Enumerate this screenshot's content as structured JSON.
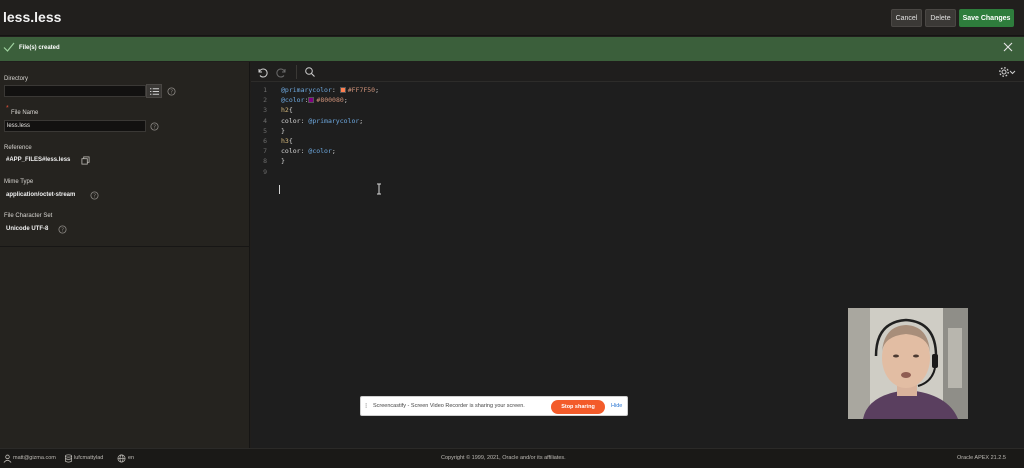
{
  "header": {
    "title": "less.less",
    "cancel_label": "Cancel",
    "delete_label": "Delete",
    "save_label": "Save Changes"
  },
  "banner": {
    "message": "File(s) created"
  },
  "form": {
    "directory": {
      "label": "Directory",
      "value": ""
    },
    "file_name": {
      "label": "File Name",
      "value": "less.less",
      "required_marker": "*"
    },
    "reference": {
      "label": "Reference",
      "value": "#APP_FILES#less.less"
    },
    "mime_type": {
      "label": "Mime Type",
      "value": "application/octet-stream"
    },
    "charset": {
      "label": "File Character Set",
      "value": "Unicode UTF-8"
    }
  },
  "editor": {
    "lines": [
      {
        "num": "1",
        "parts": [
          [
            "kw",
            "@primarycolor"
          ],
          [
            "plain",
            ": "
          ],
          [
            "swatch",
            "#FF7F50"
          ],
          [
            "lit",
            "#FF7F50"
          ],
          [
            "plain",
            ";"
          ]
        ]
      },
      {
        "num": "2",
        "parts": [
          [
            "kw",
            "@color"
          ],
          [
            "plain",
            ":"
          ],
          [
            "swatch",
            "#800080"
          ],
          [
            "lit",
            "#800080"
          ],
          [
            "plain",
            ";"
          ]
        ]
      },
      {
        "num": "3",
        "parts": [
          [
            "sel",
            "h2"
          ],
          [
            "plain",
            "{"
          ]
        ]
      },
      {
        "num": "4",
        "parts": [
          [
            "plain",
            "color: "
          ],
          [
            "kw",
            "@primarycolor"
          ],
          [
            "plain",
            ";"
          ]
        ]
      },
      {
        "num": "5",
        "parts": [
          [
            "plain",
            "}"
          ]
        ]
      },
      {
        "num": "6",
        "parts": [
          [
            "sel",
            "h3"
          ],
          [
            "plain",
            "{"
          ]
        ]
      },
      {
        "num": "7",
        "parts": [
          [
            "plain",
            "color: "
          ],
          [
            "kw",
            "@color"
          ],
          [
            "plain",
            ";"
          ]
        ]
      },
      {
        "num": "8",
        "parts": [
          [
            "plain",
            "}"
          ]
        ]
      },
      {
        "num": "9",
        "parts": []
      }
    ]
  },
  "share_bar": {
    "grip": "⁞",
    "message": "Screencastify - Screen Video Recorder is sharing your screen.",
    "stop_label": "Stop sharing",
    "hide_label": "Hide"
  },
  "footer": {
    "user": "matt@gizma.com",
    "workspace": "lufcmattylad",
    "language": "en",
    "copyright": "Copyright © 1999, 2021, Oracle and/or its affiliates.",
    "version": "Oracle APEX 21.2.5"
  },
  "colors": {
    "save_button": "#2e7d3c",
    "banner": "#3b5f3b",
    "stop_button": "#f35b2a"
  }
}
